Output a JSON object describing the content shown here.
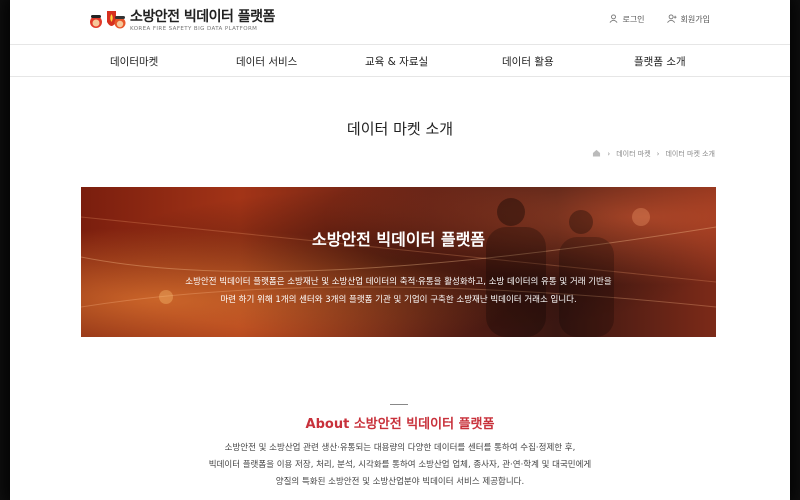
{
  "header": {
    "logo_title": "소방안전 빅데이터 플랫폼",
    "logo_subtitle": "KOREA FIRE SAFETY BIG DATA PLATFORM",
    "login_label": "로그인",
    "signup_label": "회원가입"
  },
  "nav": {
    "items": [
      "데이터마켓",
      "데이터 서비스",
      "교육 & 자료실",
      "데이터 활용",
      "플랫폼 소개"
    ]
  },
  "page": {
    "title": "데이터 마켓 소개",
    "breadcrumb": [
      "데이터 마켓",
      "데이터 마켓 소개"
    ]
  },
  "hero": {
    "title": "소방안전 빅데이터 플랫폼",
    "desc_line1": "소방안전 빅데이터 플랫폼은 소방재난 및 소방산업 데이터의 축적·유통을 활성화하고, 소방 데이터의 유통 및 거래 기반을",
    "desc_line2": "마련 하기 위해 1개의 센터와 3개의 플랫폼 기관 및 기업이 구축한 소방재난 빅데이터 거래소 입니다."
  },
  "about": {
    "title": "About 소방안전 빅데이터 플랫폼",
    "line1": "소방안전 및 소방산업 관련 생산·유통되는 대용량의 다양한 데이터를 센터를 통하여 수집·정제한 후,",
    "line2": "빅데이터 플랫폼을 이용 저장, 처리, 분석, 시각화를 통하여 소방산업 업체, 종사자, 관·연·학계 및 대국민에게",
    "line3": "양질의 특화된 소방안전 및 소방산업분야 빅데이터 서비스 제공합니다."
  },
  "colors": {
    "accent": "#c8313b"
  }
}
